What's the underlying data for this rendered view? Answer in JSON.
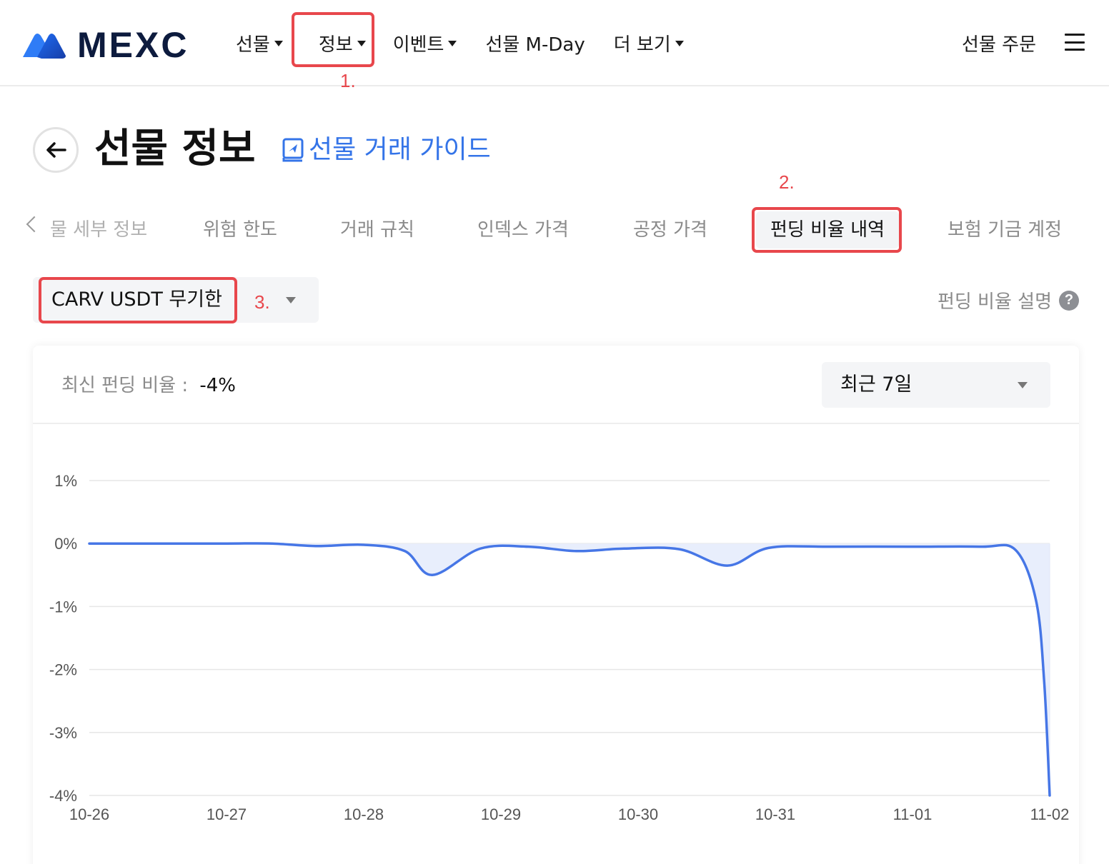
{
  "header": {
    "logo_text": "MEXC",
    "nav": [
      {
        "label": "선물",
        "dropdown": true
      },
      {
        "label": "정보",
        "dropdown": true
      },
      {
        "label": "이벤트",
        "dropdown": true
      },
      {
        "label": "선물 M-Day",
        "dropdown": false
      },
      {
        "label": "더 보기",
        "dropdown": true
      }
    ],
    "futures_order": "선물 주문"
  },
  "annotations": {
    "step1": "1.",
    "step2": "2.",
    "step3": "3."
  },
  "title": {
    "text": "선물 정보",
    "guide_link": "선물 거래 가이드"
  },
  "tabs": [
    {
      "label": "물 세부 정보",
      "active": false
    },
    {
      "label": "위험 한도",
      "active": false
    },
    {
      "label": "거래 규칙",
      "active": false
    },
    {
      "label": "인덱스 가격",
      "active": false
    },
    {
      "label": "공정 가격",
      "active": false
    },
    {
      "label": "펀딩 비율 내역",
      "active": true
    },
    {
      "label": "보험 기금 계정",
      "active": false
    }
  ],
  "contract_select": {
    "value": "CARV USDT 무기한"
  },
  "funding_explain": {
    "label": "펀딩 비율 설명",
    "icon": "?"
  },
  "card": {
    "latest_label": "최신 펀딩 비율 :",
    "latest_value": "-4%",
    "period": "최근 7일"
  },
  "colors": {
    "accent": "#3474e8",
    "line": "#4676e6",
    "fill": "#e8eefc",
    "annotation": "#e8474c"
  },
  "chart_data": {
    "type": "area",
    "x_ticks": [
      "10-26",
      "10-27",
      "10-28",
      "10-29",
      "10-30",
      "10-31",
      "11-01",
      "11-02"
    ],
    "y_ticks": [
      "1%",
      "0%",
      "-1%",
      "-2%",
      "-3%",
      "-4%"
    ],
    "ylim": [
      -4,
      1
    ],
    "grid": true,
    "series": [
      {
        "values": [
          [
            0.0,
            0.0
          ],
          [
            0.5,
            0.0
          ],
          [
            1.0,
            0.0
          ],
          [
            1.33,
            0.0
          ],
          [
            1.65,
            -0.04
          ],
          [
            2.0,
            -0.02
          ],
          [
            2.3,
            -0.12
          ],
          [
            2.5,
            -0.5
          ],
          [
            2.85,
            -0.08
          ],
          [
            3.2,
            -0.05
          ],
          [
            3.55,
            -0.12
          ],
          [
            3.9,
            -0.08
          ],
          [
            4.3,
            -0.09
          ],
          [
            4.65,
            -0.35
          ],
          [
            4.95,
            -0.07
          ],
          [
            5.4,
            -0.05
          ],
          [
            6.0,
            -0.05
          ],
          [
            6.5,
            -0.05
          ],
          [
            6.75,
            -0.1
          ],
          [
            6.9,
            -0.9
          ],
          [
            6.96,
            -2.2
          ],
          [
            7.0,
            -4.0
          ]
        ]
      }
    ]
  }
}
